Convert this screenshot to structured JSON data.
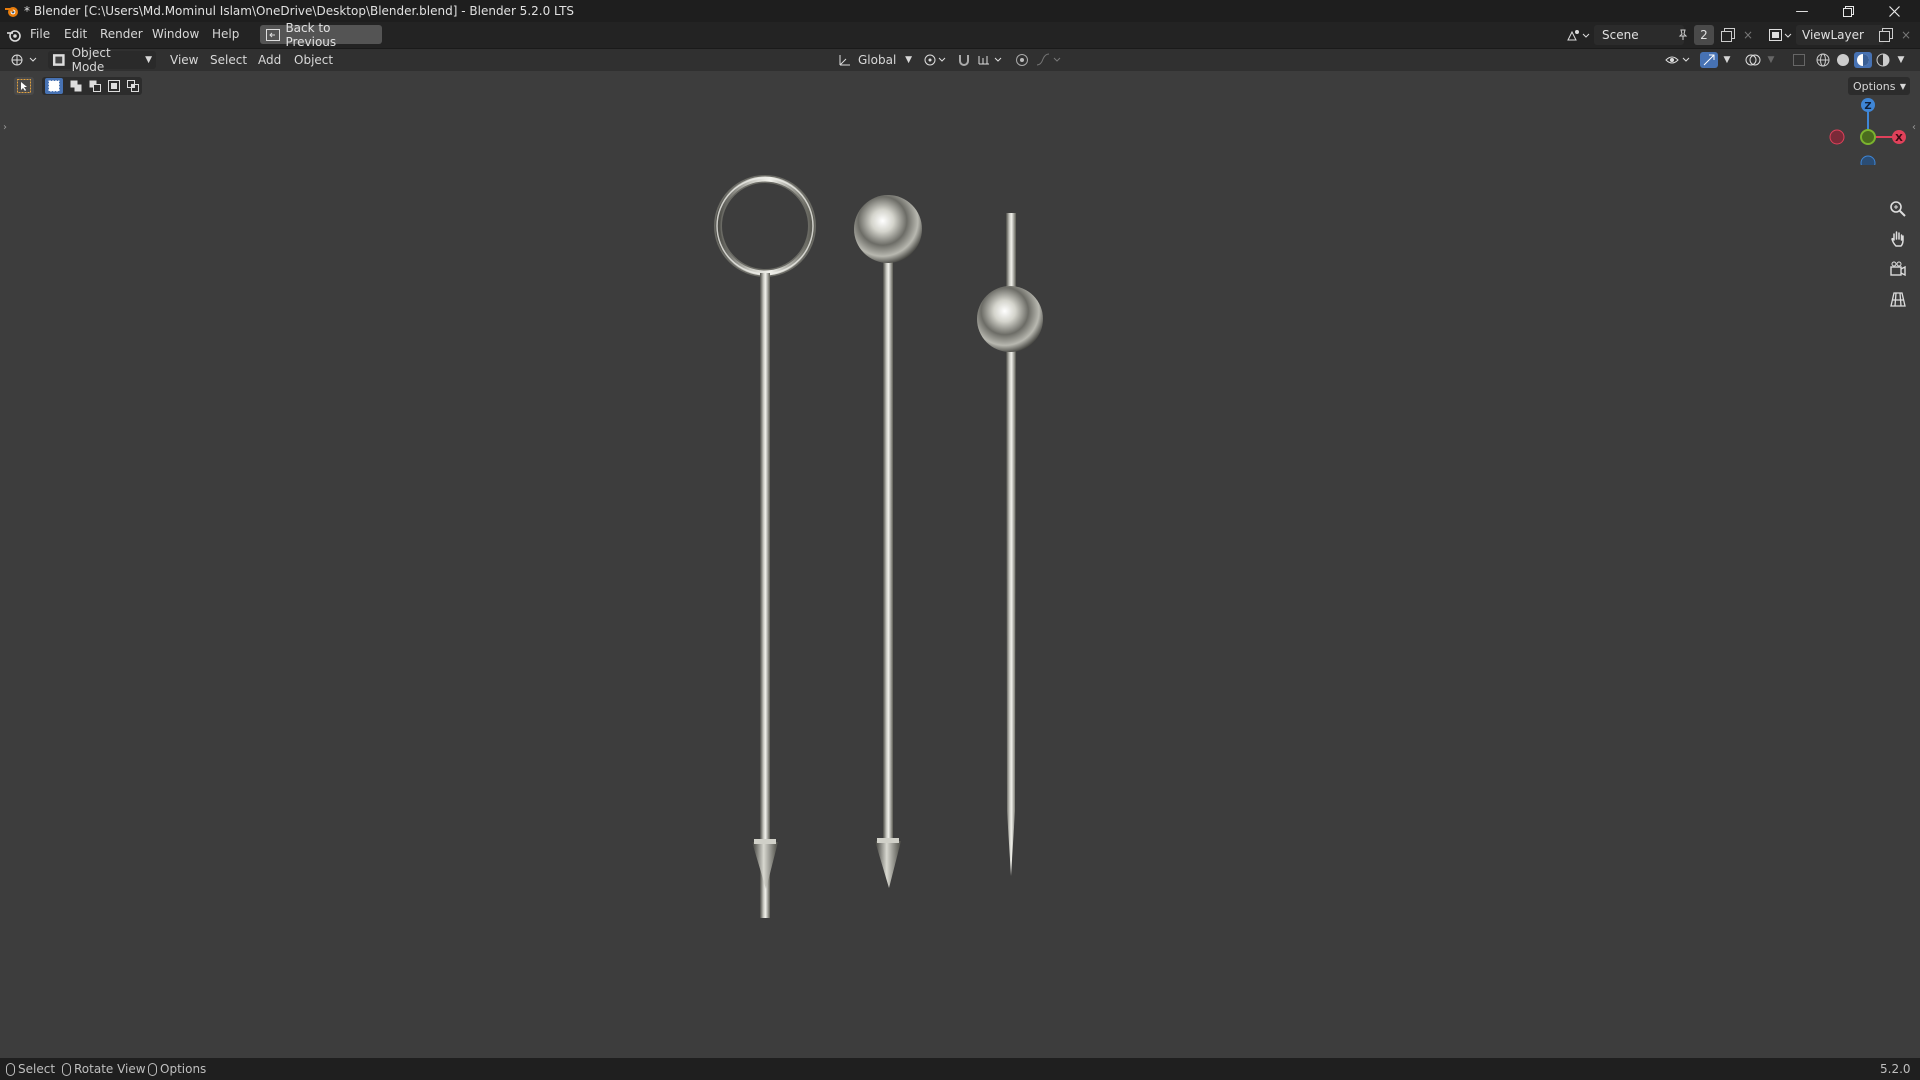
{
  "window": {
    "title": "* Blender [C:\\Users\\Md.Mominul Islam\\OneDrive\\Desktop\\Blender.blend] - Blender 5.2.0 LTS",
    "app_icon": "blender-logo-icon"
  },
  "menu": {
    "items": [
      "File",
      "Edit",
      "Render",
      "Window",
      "Help"
    ],
    "back_button": "Back to Previous",
    "scene_label": "Scene",
    "scene_users": "2",
    "view_layer_label": "ViewLayer"
  },
  "viewport_header": {
    "mode": "Object Mode",
    "menus": [
      "View",
      "Select",
      "Add",
      "Object"
    ],
    "transform_orientation": "Global",
    "options_label": "Options"
  },
  "gizmo": {
    "x_label": "X",
    "z_label": "Z",
    "colors": {
      "x": "#e0415a",
      "y": "#7bb32e",
      "z": "#3f86d6"
    }
  },
  "scene_objects": [
    "ring-head-pin",
    "ball-head-pin",
    "sliding-ball-needle"
  ],
  "status": {
    "select": "Select",
    "rotate": "Rotate View",
    "options": "Options",
    "version": "5.2.0"
  },
  "colors": {
    "accent": "#4772b3",
    "background": "#3d3d3d"
  }
}
